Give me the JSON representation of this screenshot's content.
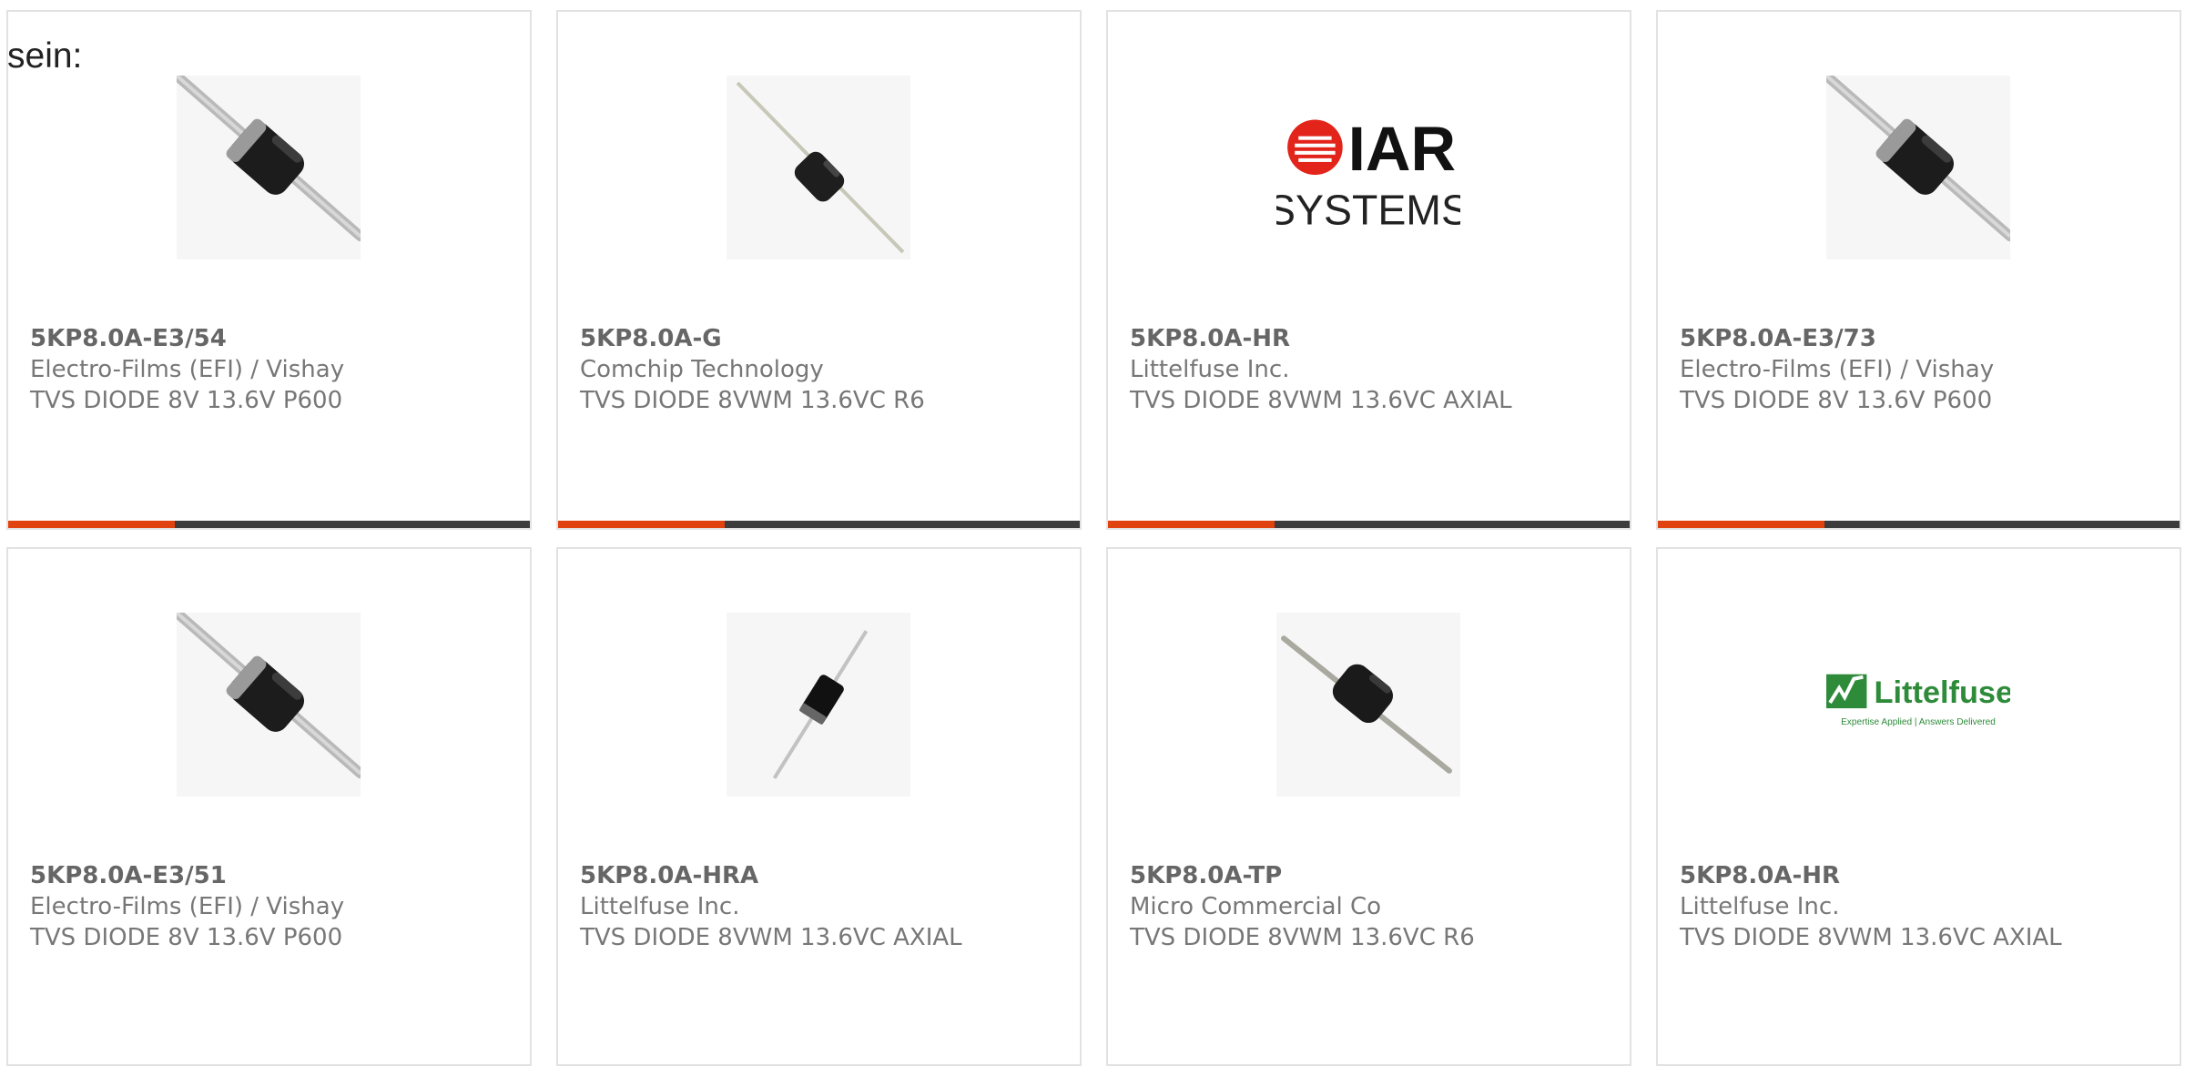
{
  "intro_text": "sein:",
  "colors": {
    "accent": "#e0430f",
    "bar": "#3c3c3c",
    "card_border": "#e2e2e2",
    "text": "#666666",
    "iar_red": "#e3241b",
    "littelfuse_green": "#2e8b3a"
  },
  "products": [
    {
      "part_number": "5KP8.0A-E3/54",
      "manufacturer": "Electro-Films (EFI) / Vishay",
      "description": "TVS DIODE 8V 13.6V P600",
      "image": "axial-diode-large-photo"
    },
    {
      "part_number": "5KP8.0A-G",
      "manufacturer": "Comchip Technology",
      "description": "TVS DIODE 8VWM 13.6VC R6",
      "image": "axial-diode-small-photo"
    },
    {
      "part_number": "5KP8.0A-HR",
      "manufacturer": "Littelfuse Inc.",
      "description": "TVS DIODE 8VWM 13.6VC AXIAL",
      "image": "iar-systems-logo",
      "logo_text": [
        "IAR",
        "SYSTEMS"
      ]
    },
    {
      "part_number": "5KP8.0A-E3/73",
      "manufacturer": "Electro-Films (EFI) / Vishay",
      "description": "TVS DIODE 8V 13.6V P600",
      "image": "axial-diode-large-photo"
    },
    {
      "part_number": "5KP8.0A-E3/51",
      "manufacturer": "Electro-Films (EFI) / Vishay",
      "description": "TVS DIODE 8V 13.6V P600",
      "image": "axial-diode-large-photo"
    },
    {
      "part_number": "5KP8.0A-HRA",
      "manufacturer": "Littelfuse Inc.",
      "description": "TVS DIODE 8VWM 13.6VC AXIAL",
      "image": "axial-diode-steep-photo"
    },
    {
      "part_number": "5KP8.0A-TP",
      "manufacturer": "Micro Commercial Co",
      "description": "TVS DIODE 8VWM 13.6VC R6",
      "image": "axial-diode-medium-photo"
    },
    {
      "part_number": "5KP8.0A-HR",
      "manufacturer": "Littelfuse Inc.",
      "description": "TVS DIODE 8VWM 13.6VC AXIAL",
      "image": "littelfuse-logo",
      "logo_text": [
        "Littelfuse",
        "Expertise Applied | Answers Delivered"
      ]
    }
  ]
}
